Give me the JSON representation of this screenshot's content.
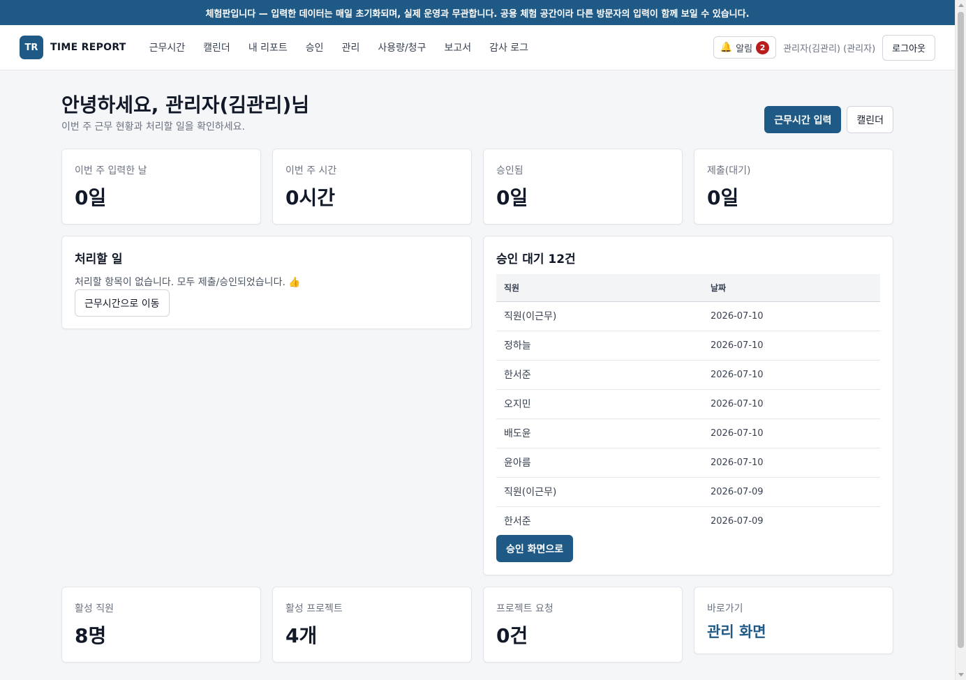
{
  "banner": {
    "text": "체험판입니다 — 입력한 데이터는 매일 초기화되며, 실제 운영과 무관합니다. 공용 체험 공간이라 다른 방문자의 입력이 함께 보일 수 있습니다."
  },
  "brand": {
    "badge": "TR",
    "name": "TIME REPORT"
  },
  "nav": {
    "items": [
      "근무시간",
      "캘린더",
      "내 리포트",
      "승인",
      "관리",
      "사용량/청구",
      "보고서",
      "감사 로그"
    ]
  },
  "header_right": {
    "alert_label": "알림",
    "alert_count": "2",
    "user": "관리자(김관리) (관리자)",
    "logout": "로그아웃"
  },
  "page": {
    "greeting": "안녕하세요, 관리자(김관리)님",
    "subtitle": "이번 주 근무 현황과 처리할 일을 확인하세요.",
    "primary_action": "근무시간 입력",
    "secondary_action": "캘린더"
  },
  "stats_top": [
    {
      "label": "이번 주 입력한 날",
      "value": "0일"
    },
    {
      "label": "이번 주 시간",
      "value": "0시간"
    },
    {
      "label": "승인됨",
      "value": "0일"
    },
    {
      "label": "제출(대기)",
      "value": "0일"
    }
  ],
  "todo": {
    "title": "처리할 일",
    "message": "처리할 항목이 없습니다. 모두 제출/승인되었습니다. 👍",
    "button": "근무시간으로 이동"
  },
  "approvals": {
    "title": "승인 대기 12건",
    "columns": [
      "직원",
      "날짜"
    ],
    "rows": [
      {
        "employee": "직원(이근무)",
        "date": "2026-07-10"
      },
      {
        "employee": "정하늘",
        "date": "2026-07-10"
      },
      {
        "employee": "한서준",
        "date": "2026-07-10"
      },
      {
        "employee": "오지민",
        "date": "2026-07-10"
      },
      {
        "employee": "배도윤",
        "date": "2026-07-10"
      },
      {
        "employee": "윤아름",
        "date": "2026-07-10"
      },
      {
        "employee": "직원(이근무)",
        "date": "2026-07-09"
      },
      {
        "employee": "한서준",
        "date": "2026-07-09"
      }
    ],
    "button": "승인 화면으로"
  },
  "stats_bottom": [
    {
      "label": "활성 직원",
      "value": "8명"
    },
    {
      "label": "활성 프로젝트",
      "value": "4개"
    },
    {
      "label": "프로젝트 요청",
      "value": "0건"
    }
  ],
  "shortcut": {
    "label": "바로가기",
    "link": "관리 화면"
  },
  "colors": {
    "brand": "#1f5a87",
    "badge": "#b91c1c",
    "background": "#f5f6f8"
  },
  "icons": {
    "alert": "bell-icon"
  }
}
